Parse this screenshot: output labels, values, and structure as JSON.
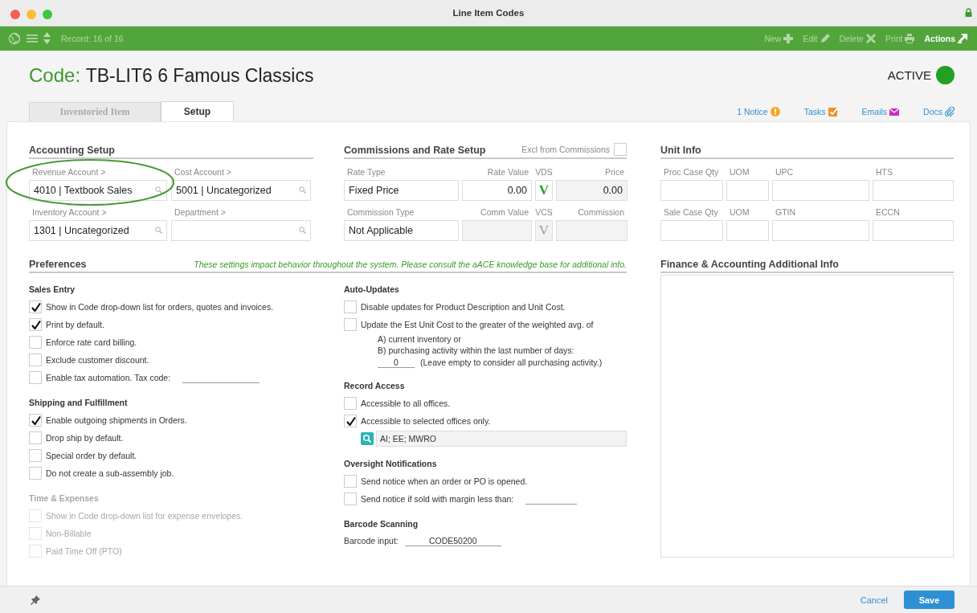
{
  "window": {
    "title": "Line Item Codes"
  },
  "toolbar": {
    "record": "Record: 16 of 16",
    "actions": [
      {
        "label": "New",
        "kind": "new",
        "disabled": true
      },
      {
        "label": "Edit",
        "kind": "edit",
        "disabled": true
      },
      {
        "label": "Delete",
        "kind": "delete",
        "disabled": true
      },
      {
        "label": "Print",
        "kind": "print",
        "disabled": true
      },
      {
        "label": "Actions",
        "kind": "actions",
        "disabled": false
      }
    ]
  },
  "header": {
    "code_label": "Code:",
    "code_value": "TB-LIT6 6 Famous Classics",
    "status": "ACTIVE"
  },
  "tabs": [
    {
      "label": "Inventoried Item",
      "selected": false
    },
    {
      "label": "Setup",
      "selected": true
    }
  ],
  "links": [
    {
      "label": "1 Notice",
      "kind": "notice"
    },
    {
      "label": "Tasks",
      "kind": "tasks"
    },
    {
      "label": "Emails",
      "kind": "emails"
    },
    {
      "label": "Docs",
      "kind": "docs"
    }
  ],
  "accounting": {
    "title": "Accounting Setup",
    "fields": [
      {
        "label": "Revenue Account >",
        "value": "4010 | Textbook Sales"
      },
      {
        "label": "Cost Account >",
        "value": "5001 | Uncategorized"
      },
      {
        "label": "Inventory Account >",
        "value": "1301 | Uncategorized"
      },
      {
        "label": "Department >"
      }
    ]
  },
  "commissions": {
    "title": "Commissions and Rate Setup",
    "excl_label": "Excl from Commissions",
    "excl_checked": false,
    "rows": [
      [
        {
          "label": "Rate Type",
          "value": "Fixed Price",
          "kind": "text",
          "disabled": false
        },
        {
          "label": "Rate Value",
          "value": "0.00",
          "kind": "number",
          "disabled": false
        },
        {
          "label": "VDS",
          "value": "V",
          "kind": "toggle",
          "disabled": false
        },
        {
          "label": "Price",
          "value": "0.00",
          "kind": "number",
          "disabled": true
        }
      ],
      [
        {
          "label": "Commission Type",
          "value": "Not Applicable",
          "kind": "text",
          "disabled": false
        },
        {
          "label": "Comm Value",
          "kind": "number",
          "disabled": true
        },
        {
          "label": "VCS",
          "value": "V",
          "kind": "toggle",
          "disabled": true
        },
        {
          "label": "Commission",
          "kind": "number",
          "disabled": true
        }
      ]
    ]
  },
  "unit_info": {
    "title": "Unit Info",
    "rows": [
      [
        {
          "label": "Proc Case Qty"
        },
        {
          "label": "UOM"
        },
        {
          "label": "UPC"
        },
        {
          "label": "HTS"
        }
      ],
      [
        {
          "label": "Sale Case Qty"
        },
        {
          "label": "UOM"
        },
        {
          "label": "GTIN"
        },
        {
          "label": "ECCN"
        }
      ]
    ]
  },
  "preferences": {
    "title": "Preferences",
    "note": "These settings impact behavior throughout the system. Please consult the aACE knowledge base for additional info.",
    "columns": [
      [
        {
          "title": "Sales Entry",
          "disabled": false,
          "items": [
            {
              "kind": "checkbox",
              "label": "Show in Code drop-down list for orders, quotes and invoices.",
              "checked": true
            },
            {
              "kind": "checkbox",
              "label": "Print by default.",
              "checked": true
            },
            {
              "kind": "checkbox",
              "label": "Enforce rate card billing.",
              "checked": false
            },
            {
              "kind": "checkbox",
              "label": "Exclude customer discount.",
              "checked": false
            },
            {
              "kind": "checkbox_field",
              "label": "Enable tax automation. Tax code:",
              "checked": false
            }
          ]
        },
        {
          "title": "Shipping and Fulfillment",
          "disabled": false,
          "items": [
            {
              "kind": "checkbox",
              "label": "Enable outgoing shipments in Orders.",
              "checked": true
            },
            {
              "kind": "checkbox",
              "label": "Drop ship by default.",
              "checked": false
            },
            {
              "kind": "checkbox",
              "label": "Special order by default.",
              "checked": false
            },
            {
              "kind": "checkbox",
              "label": "Do not create a sub-assembly job.",
              "checked": false
            }
          ]
        },
        {
          "title": "Time & Expenses",
          "disabled": true,
          "items": [
            {
              "kind": "checkbox",
              "label": "Show in Code drop-down list for expense envelopes.",
              "checked": false
            },
            {
              "kind": "checkbox",
              "label": "Non-Billable",
              "checked": false
            },
            {
              "kind": "checkbox",
              "label": "Paid Time Off (PTO)",
              "checked": false
            }
          ]
        }
      ],
      [
        {
          "title": "Auto-Updates",
          "disabled": false,
          "items": [
            {
              "kind": "checkbox",
              "label": "Disable updates for Product Description and Unit Cost.",
              "checked": false
            },
            {
              "kind": "checkbox_detail",
              "label": "Update the Est Unit Cost to the greater of the weighted avg. of",
              "checked": false,
              "lines": [
                "A) current inventory or",
                "B) purchasing activity within the last number of days:"
              ],
              "days": "0",
              "days_note": "(Leave empty to consider all purchasing activity.)"
            }
          ]
        },
        {
          "title": "Record Access",
          "disabled": false,
          "items": [
            {
              "kind": "checkbox",
              "label": "Accessible to all offices.",
              "checked": false
            },
            {
              "kind": "checkbox",
              "label": "Accessible to selected offices only.",
              "checked": true
            },
            {
              "kind": "offices",
              "value": "AI; EE; MWRO"
            }
          ]
        },
        {
          "title": "Oversight Notifications",
          "disabled": false,
          "items": [
            {
              "kind": "checkbox",
              "label": "Send notice when an order or PO is opened.",
              "checked": false
            },
            {
              "kind": "checkbox_field",
              "label": "Send notice if sold with margin less than:",
              "checked": false
            }
          ]
        },
        {
          "title": "Barcode Scanning",
          "disabled": false,
          "items": [
            {
              "kind": "input",
              "label": "Barcode input:",
              "value": "CODE50200"
            }
          ]
        }
      ]
    ]
  },
  "finance": {
    "title": "Finance & Accounting Additional Info"
  },
  "footer": {
    "cancel": "Cancel",
    "save": "Save"
  }
}
